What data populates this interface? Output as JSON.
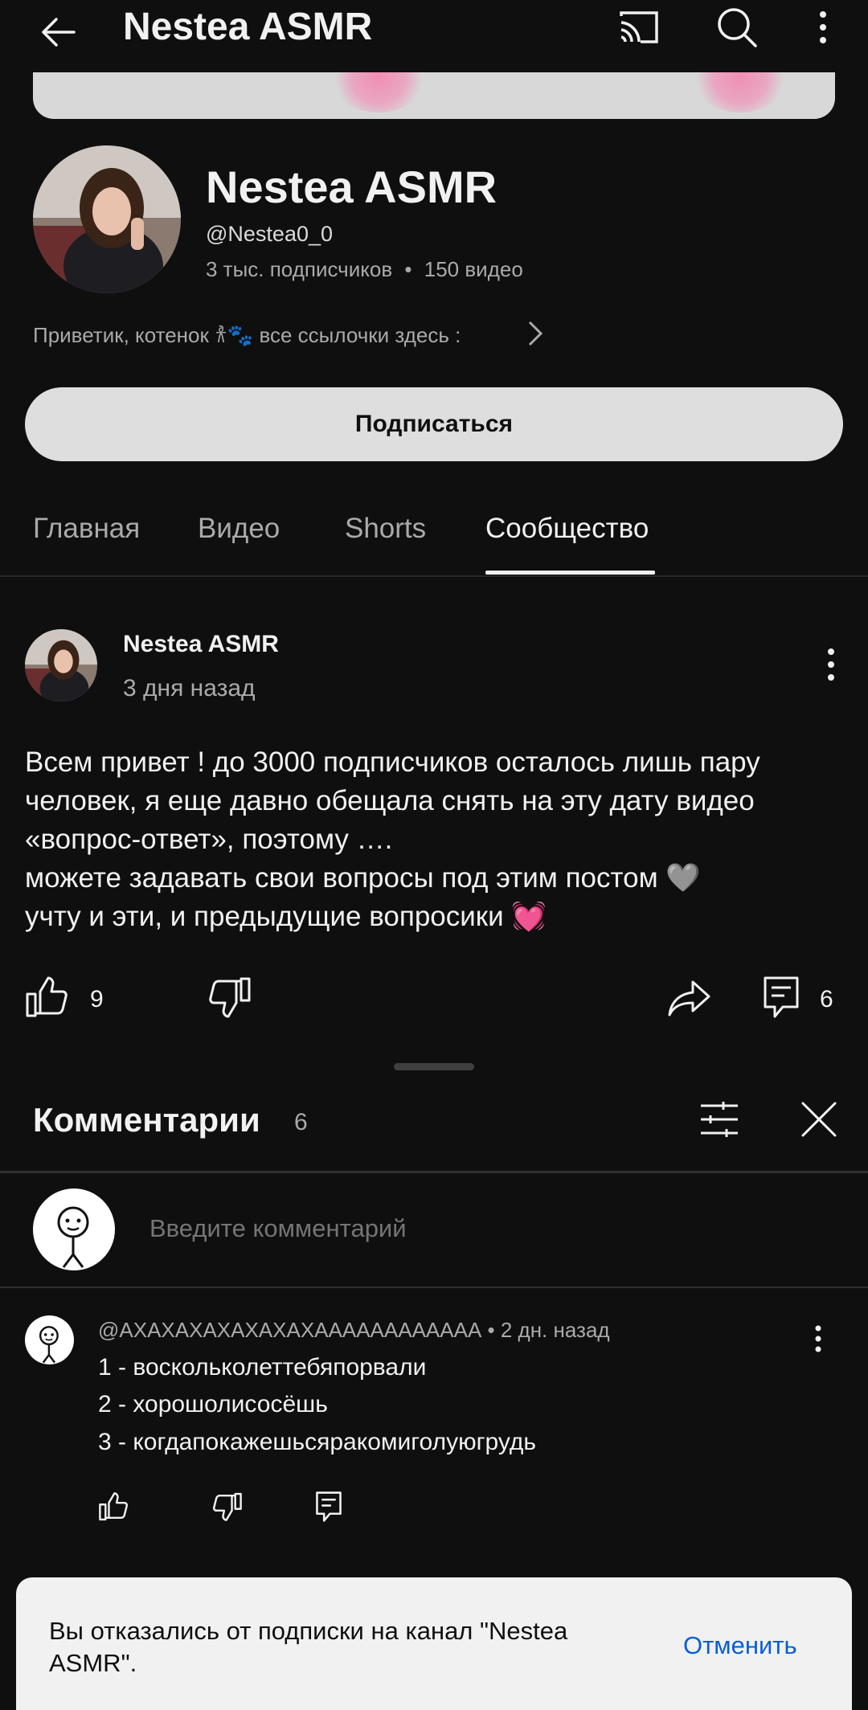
{
  "topbar": {
    "title": "Nestea ASMR",
    "back_icon": "arrow-left-icon",
    "cast_icon": "cast-icon",
    "search_icon": "search-icon",
    "more_icon": "more-vertical-icon"
  },
  "channel": {
    "name": "Nestea ASMR",
    "handle": "@Nestea0_0",
    "subscribers": "3 тыс. подписчиков",
    "separator": "•",
    "videos": "150 видео",
    "description": "Приветик, котенок 𐀪🐾 все ссылочки здесь :",
    "subscribe_label": "Подписаться"
  },
  "tabs": [
    {
      "label": "Главная"
    },
    {
      "label": "Видео"
    },
    {
      "label": "Shorts"
    },
    {
      "label": "Сообщество",
      "active": true
    }
  ],
  "post": {
    "author": "Nestea ASMR",
    "time": "3 дня назад",
    "lines": [
      "Всем привет ! до 3000 подписчиков осталось лишь пару",
      "человек, я еще давно обещала снять на эту дату видео",
      "«вопрос-ответ», поэтому ….",
      "можете задавать свои вопросы под этим постом 🩶",
      "учту и эти, и предыдущие вопросики 💓"
    ],
    "likes": "9",
    "comments": "6"
  },
  "comments_sheet": {
    "title": "Комментарии",
    "count": "6",
    "input_placeholder": "Введите комментарий",
    "items": [
      {
        "author": "@АХАХАХАХАХАХАХАААААААААААА",
        "time": "2 дн. назад",
        "lines": [
          "1 - воскольколеттебяпорвали",
          "2 - хорошолисосёшь",
          "3 - когдапокажешьсяракомиголуюгрудь"
        ]
      }
    ]
  },
  "toast": {
    "message": "Вы отказались от подписки на канал \"Nestea ASMR\".",
    "action": "Отменить"
  },
  "colors": {
    "background": "#0f0f0f",
    "accent_blue": "#065fd4",
    "secondary_text": "#aaaaaa"
  }
}
